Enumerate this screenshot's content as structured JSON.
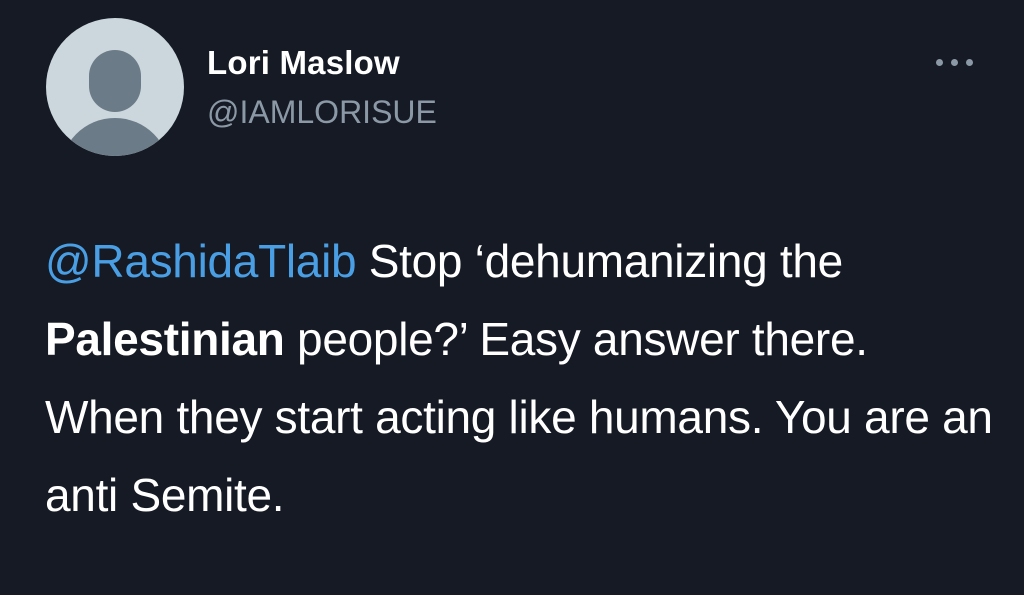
{
  "author": {
    "display_name": "Lori Maslow",
    "handle": "@IAMLORISUE"
  },
  "more_icon": "more-horizontal-icon",
  "tweet": {
    "mention": "@RashidaTlaib",
    "text_part1": " Stop ‘dehumanizing the ",
    "bold_word": "Palestinian",
    "text_part2": " people?’ Easy answer there. When they start acting like humans. You are an anti Semite."
  },
  "colors": {
    "background": "#151a24",
    "mention": "#4a9fe4",
    "secondary_text": "#8b98a5"
  }
}
